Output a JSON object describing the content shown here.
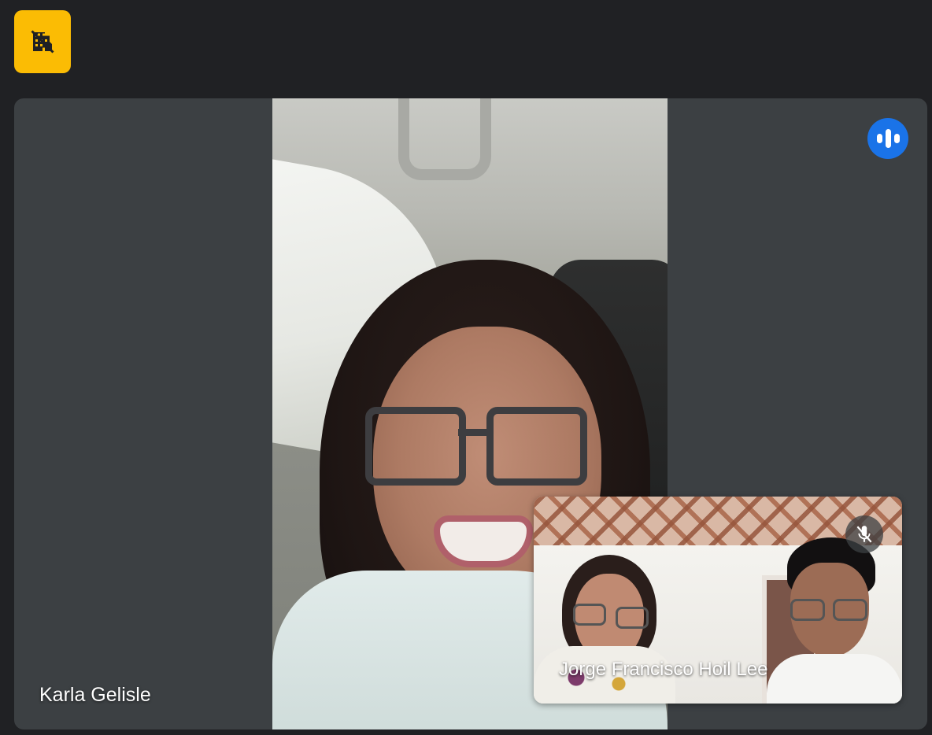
{
  "toolbar": {
    "badge_icon": "no-building-icon",
    "badge_color": "#fbbc04"
  },
  "main_tile": {
    "participant_name": "Karla Gelisle",
    "speaking_icon": "audio-level-icon",
    "speaking_color": "#1a73e8"
  },
  "pip_tile": {
    "participant_name": "Jorge Francisco Hoil Lee",
    "mute_icon": "mic-off-icon"
  },
  "colors": {
    "background": "#202124",
    "tile_background": "#3c4043"
  }
}
